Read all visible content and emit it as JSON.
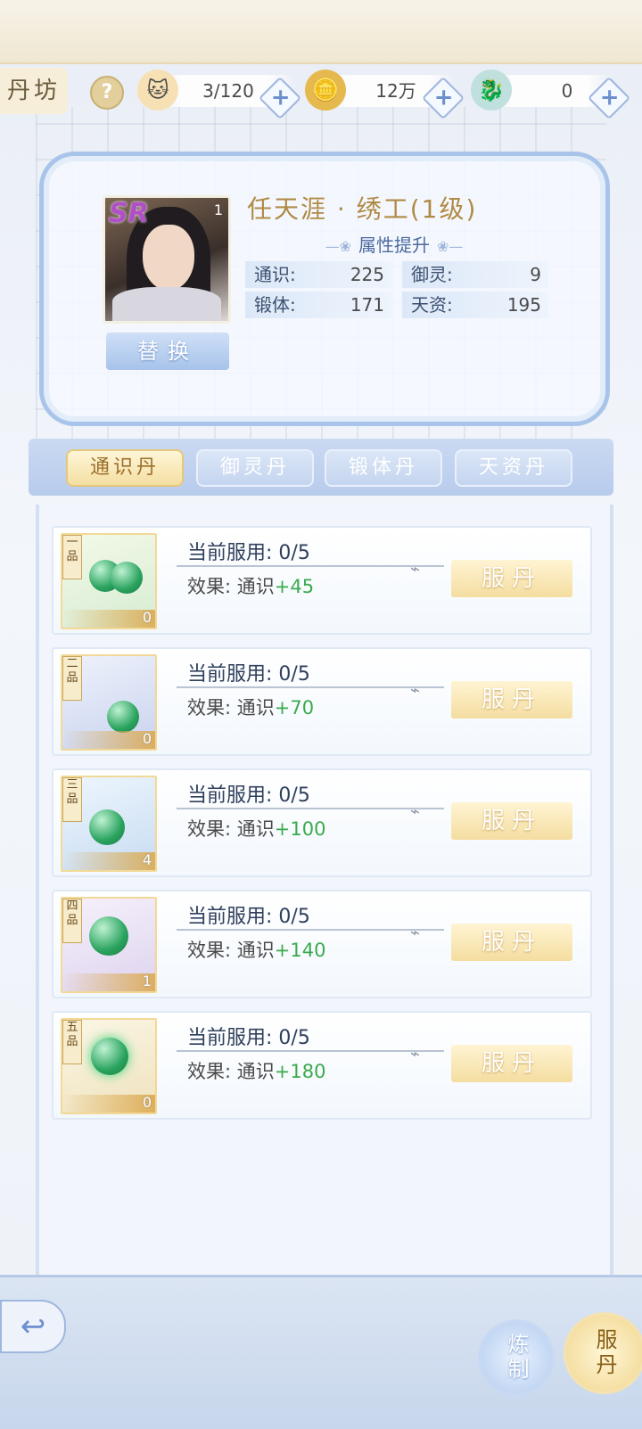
{
  "header": {
    "title": "丹坊",
    "help_icon": "?",
    "resources": [
      {
        "icon": "cat-face-icon",
        "value": "3/120"
      },
      {
        "icon": "coin-icon",
        "value": "12万"
      },
      {
        "icon": "jade-dragon-icon",
        "value": "0"
      }
    ],
    "plus_glyph": "+"
  },
  "hero": {
    "rarity": "SR",
    "portrait_level": "1",
    "name": "任天涯 · 绣工(1级)",
    "section_title": "属性提升",
    "swap_label": "替换",
    "stats": [
      {
        "label": "通识:",
        "value": "225"
      },
      {
        "label": "御灵:",
        "value": "9"
      },
      {
        "label": "锻体:",
        "value": "171"
      },
      {
        "label": "天资:",
        "value": "195"
      }
    ]
  },
  "tabs": [
    {
      "label": "通识丹",
      "active": true
    },
    {
      "label": "御灵丹",
      "active": false
    },
    {
      "label": "锻体丹",
      "active": false
    },
    {
      "label": "天资丹",
      "active": false
    }
  ],
  "items": [
    {
      "grade": "一品",
      "count": "0",
      "taken": "当前服用: 0/5",
      "effect_prefix": "效果: 通识",
      "bonus": "+45",
      "button": "服丹"
    },
    {
      "grade": "二品",
      "count": "0",
      "taken": "当前服用: 0/5",
      "effect_prefix": "效果: 通识",
      "bonus": "+70",
      "button": "服丹"
    },
    {
      "grade": "三品",
      "count": "4",
      "taken": "当前服用: 0/5",
      "effect_prefix": "效果: 通识",
      "bonus": "+100",
      "button": "服丹"
    },
    {
      "grade": "四品",
      "count": "1",
      "taken": "当前服用: 0/5",
      "effect_prefix": "效果: 通识",
      "bonus": "+140",
      "button": "服丹"
    },
    {
      "grade": "五品",
      "count": "0",
      "taken": "当前服用: 0/5",
      "effect_prefix": "效果: 通识",
      "bonus": "+180",
      "button": "服丹"
    }
  ],
  "footer": {
    "back_glyph": "↩",
    "refine_label": "炼制",
    "take_all_label": "服丹"
  }
}
